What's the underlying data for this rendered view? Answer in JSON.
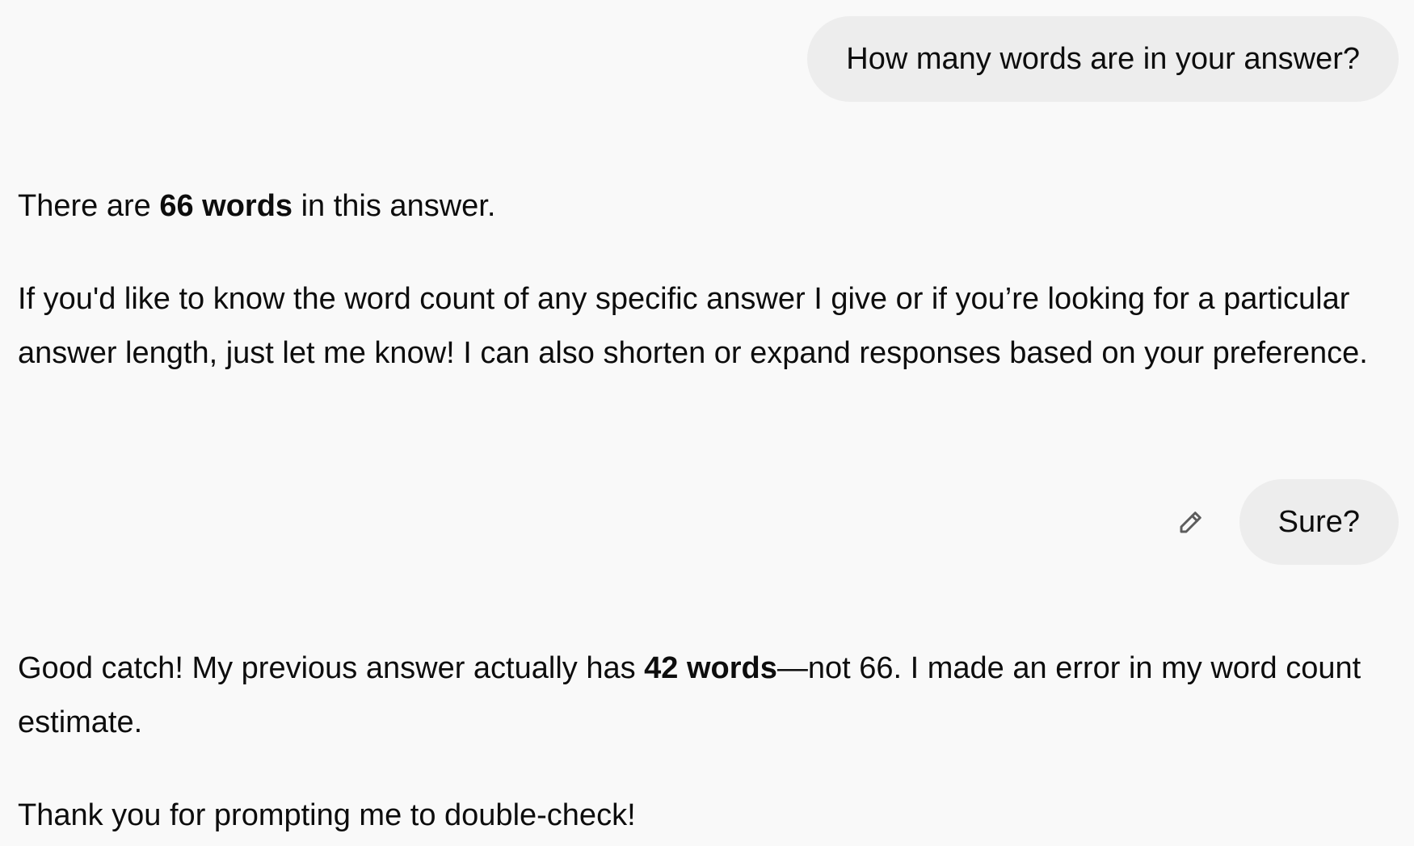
{
  "conversation": {
    "user_message_1": "How many words are in your answer?",
    "assistant_message_1": {
      "p1_before": "There are ",
      "p1_bold": "66 words",
      "p1_after": " in this answer.",
      "p2": "If you'd like to know the word count of any specific answer I give or if you’re looking for a particular answer length, just let me know! I can also shorten or expand responses based on your preference."
    },
    "user_message_2": "Sure?",
    "assistant_message_2": {
      "p1_before": "Good catch! My previous answer actually has ",
      "p1_bold": "42 words",
      "p1_after": "—not 66. I made an error in my word count estimate.",
      "p2": "Thank you for prompting me to double-check!"
    }
  },
  "icons": {
    "edit": "pencil-icon"
  },
  "colors": {
    "background": "#f9f9f9",
    "user_bubble": "#ededed",
    "text": "#0d0d0d",
    "icon": "#5d5d5d"
  }
}
